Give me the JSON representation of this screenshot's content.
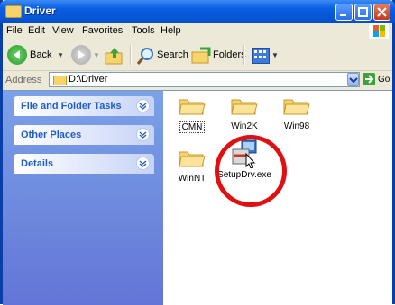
{
  "window": {
    "title": "Driver"
  },
  "menu": [
    "File",
    "Edit",
    "View",
    "Favorites",
    "Tools",
    "Help"
  ],
  "toolbar": {
    "back_label": "Back",
    "search_label": "Search",
    "folders_label": "Folders"
  },
  "address": {
    "label": "Address",
    "path": "D:\\Driver",
    "go_label": "Go"
  },
  "tasks": [
    {
      "label": "File and Folder Tasks"
    },
    {
      "label": "Other Places"
    },
    {
      "label": "Details"
    }
  ],
  "files": [
    {
      "name": "CMN",
      "icon": "folder-icon"
    },
    {
      "name": "Win2K",
      "icon": "folder-icon"
    },
    {
      "name": "Win98",
      "icon": "folder-icon"
    },
    {
      "name": "WinNT",
      "icon": "folder-icon"
    },
    {
      "name": "SetupDrv.exe",
      "icon": "setup-exe-icon"
    }
  ],
  "colors": {
    "titlebar": "#0b5fe4",
    "taskpane": "#6375d6",
    "highlight_ring": "#e01010"
  }
}
